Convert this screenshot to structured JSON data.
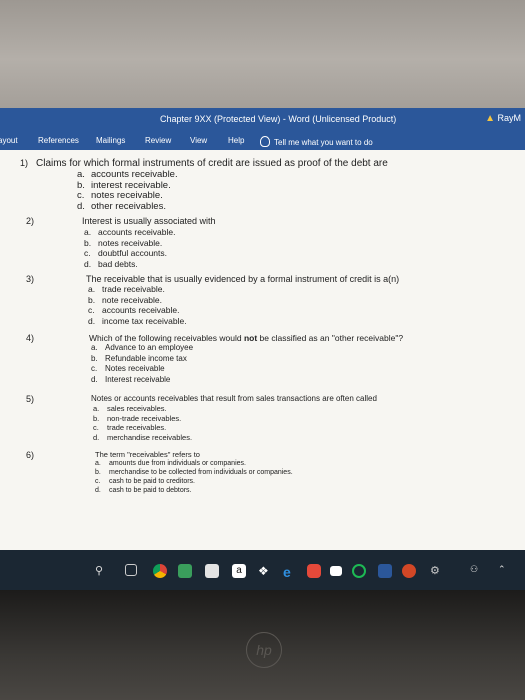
{
  "window": {
    "title": "Chapter 9XX (Protected View)  -  Word (Unlicensed Product)",
    "user": "RayM"
  },
  "ribbon": {
    "tabs": [
      "ayout",
      "References",
      "Mailings",
      "Review",
      "View",
      "Help"
    ],
    "tell_me": "Tell me what you want to do"
  },
  "questions": [
    {
      "number": "1)",
      "text": "Claims for which formal instruments of credit are issued as proof of the debt are",
      "options": [
        {
          "letter": "a.",
          "text": "accounts receivable."
        },
        {
          "letter": "b.",
          "text": "interest receivable."
        },
        {
          "letter": "c.",
          "text": "notes receivable."
        },
        {
          "letter": "d.",
          "text": "other receivables."
        }
      ]
    },
    {
      "number": "2)",
      "text": "Interest is usually associated with",
      "options": [
        {
          "letter": "a.",
          "text": "accounts receivable."
        },
        {
          "letter": "b.",
          "text": "notes receivable."
        },
        {
          "letter": "c.",
          "text": "doubtful accounts."
        },
        {
          "letter": "d.",
          "text": "bad debts."
        }
      ]
    },
    {
      "number": "3)",
      "text": "The receivable that is usually evidenced by a formal instrument of credit is a(n)",
      "options": [
        {
          "letter": "a.",
          "text": "trade receivable."
        },
        {
          "letter": "b.",
          "text": "note receivable."
        },
        {
          "letter": "c.",
          "text": "accounts receivable."
        },
        {
          "letter": "d.",
          "text": "income tax receivable."
        }
      ]
    },
    {
      "number": "4)",
      "text_before": "Which of the following receivables would ",
      "text_bold": "not",
      "text_after": " be classified as an \"other receivable\"?",
      "options": [
        {
          "letter": "a.",
          "text": "Advance to an employee"
        },
        {
          "letter": "b.",
          "text": "Refundable income tax"
        },
        {
          "letter": "c.",
          "text": "Notes receivable"
        },
        {
          "letter": "d.",
          "text": "Interest receivable"
        }
      ]
    },
    {
      "number": "5)",
      "text": "Notes or accounts receivables that result from sales transactions are often called",
      "options": [
        {
          "letter": "a.",
          "text": "sales receivables."
        },
        {
          "letter": "b.",
          "text": "non-trade receivables."
        },
        {
          "letter": "c.",
          "text": "trade receivables."
        },
        {
          "letter": "d.",
          "text": "merchandise receivables."
        }
      ]
    },
    {
      "number": "6)",
      "text": "The term \"receivables\" refers to",
      "options": [
        {
          "letter": "a.",
          "text": "amounts due from individuals or companies."
        },
        {
          "letter": "b.",
          "text": "merchandise to be collected from individuals or companies."
        },
        {
          "letter": "c.",
          "text": "cash to be paid to creditors."
        },
        {
          "letter": "d.",
          "text": "cash to be paid to debtors."
        }
      ]
    }
  ],
  "taskbar": {
    "icons": [
      "pin-icon",
      "task-view-icon",
      "chrome-icon",
      "photos-icon",
      "store-icon",
      "amazon-icon",
      "dropbox-icon",
      "edge-icon",
      "app-icon",
      "mail-icon",
      "spotify-icon",
      "word-icon",
      "powerpoint-icon",
      "settings-icon",
      "people-icon",
      "up-arrow-icon"
    ],
    "amazon_label": "a"
  },
  "colors": {
    "word_blue": "#2b579a",
    "taskbar": "#1b2733"
  }
}
